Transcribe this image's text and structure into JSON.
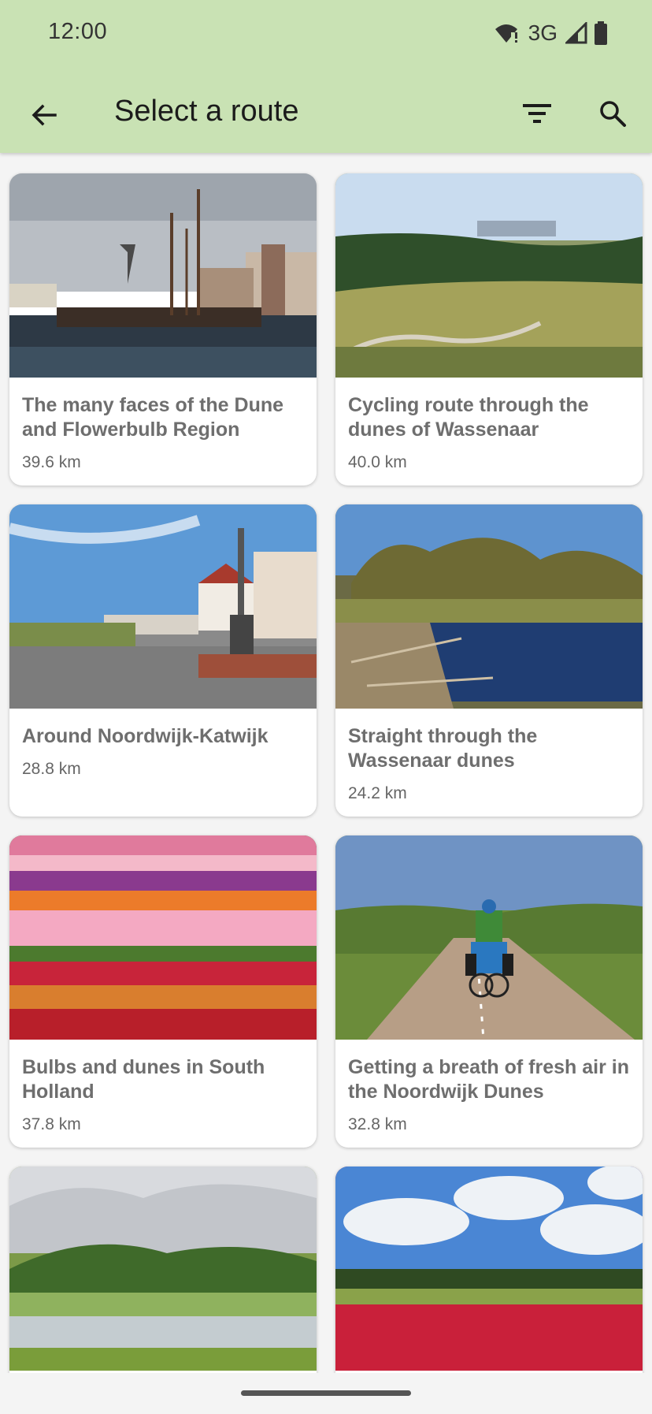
{
  "status_bar": {
    "time": "12:00",
    "network": "3G",
    "icons": [
      "wifi-alert-icon",
      "signal-icon",
      "battery-icon"
    ]
  },
  "app_bar": {
    "title": "Select a route",
    "icons": [
      "back-arrow-icon",
      "filter-icon",
      "search-icon"
    ],
    "background": "#c9e2b4"
  },
  "routes": [
    {
      "title": "The many faces of the Dune and Flowerbulb Region",
      "distance": "39.6 km",
      "image": "harbor with sailing ships and windmill"
    },
    {
      "title": "Cycling route through the dunes of Wassenaar",
      "distance": "40.0 km",
      "image": "dune landscape with cycle path"
    },
    {
      "title": "Around Noordwijk-Katwijk",
      "distance": "28.8 km",
      "image": "seaside boulevard with statue"
    },
    {
      "title": "Straight through the Wassenaar dunes",
      "distance": "24.2 km",
      "image": "pond with trees"
    },
    {
      "title": "Bulbs and dunes in South Holland",
      "distance": "37.8 km",
      "image": "rows of colourful tulips"
    },
    {
      "title": "Getting a breath of fresh air in the Noordwijk Dunes",
      "distance": "32.8 km",
      "image": "cyclist on dune path"
    },
    {
      "title": "",
      "distance": "",
      "image": "green dunes with lake"
    },
    {
      "title": "",
      "distance": "",
      "image": "red tulip field under clouds"
    }
  ]
}
